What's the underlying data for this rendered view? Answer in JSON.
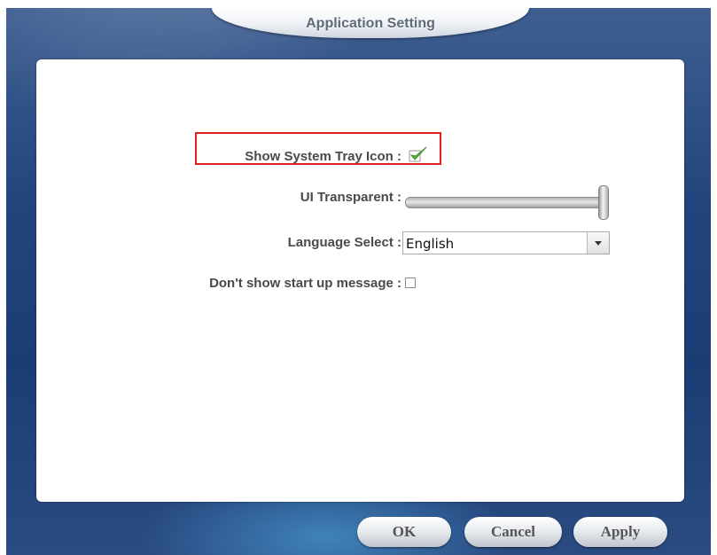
{
  "window": {
    "title": "Application Setting"
  },
  "settings": {
    "system_tray": {
      "label": "Show System Tray Icon :",
      "checked": true
    },
    "transparency": {
      "label": "UI Transparent :",
      "level_percent": 100
    },
    "language": {
      "label": "Language Select :",
      "value": "English"
    },
    "startup_message": {
      "label": "Don't show start up message :",
      "checked": false
    }
  },
  "buttons": {
    "ok": "OK",
    "cancel": "Cancel",
    "apply": "Apply"
  },
  "colors": {
    "highlight": "#e02020",
    "check": "#57b73a"
  }
}
